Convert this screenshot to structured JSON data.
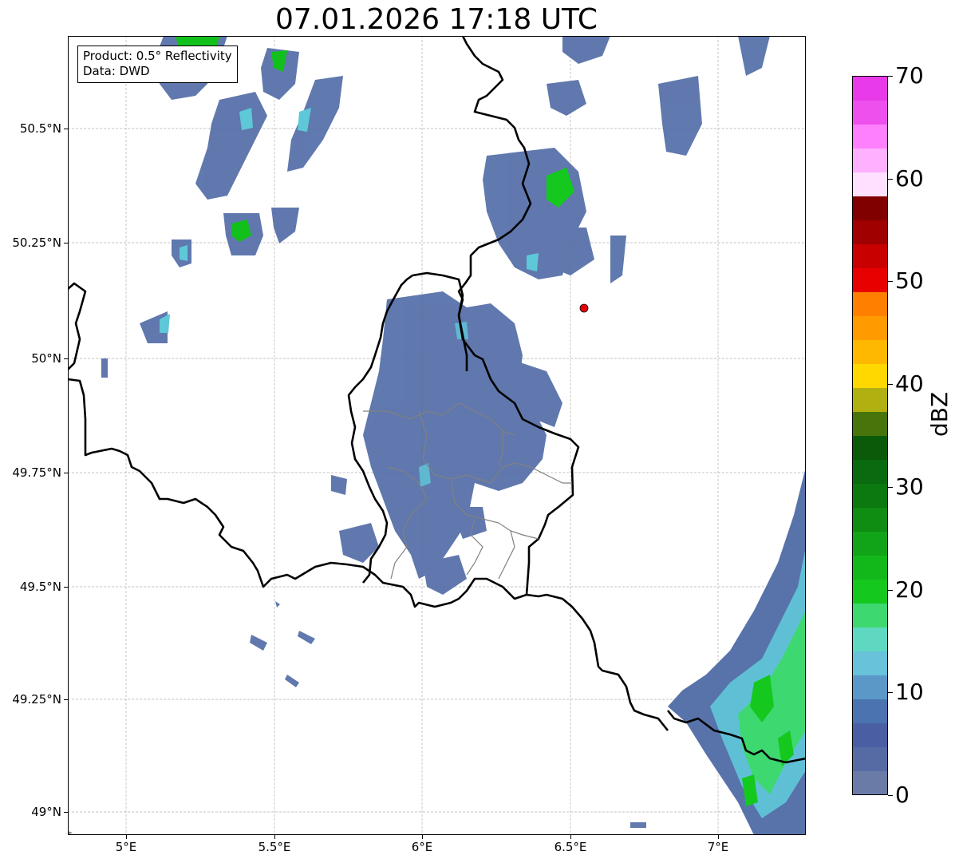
{
  "title": "07.01.2026 17:18 UTC",
  "info_box": {
    "product": "Product: 0.5° Reflectivity",
    "data": "Data: DWD"
  },
  "map": {
    "lat_ticks": [
      "50.5°N",
      "50.25°N",
      "50°N",
      "49.75°N",
      "49.5°N",
      "49.25°N",
      "49°N"
    ],
    "lon_ticks": [
      "5°E",
      "5.5°E",
      "6°E",
      "6.5°E",
      "7°E"
    ],
    "gridlines": true,
    "marker_color": "#e8000b",
    "border_color": "#000000",
    "admin_border_color": "#808080"
  },
  "colorbar": {
    "label": "dBZ",
    "ticks": [
      "0",
      "10",
      "20",
      "30",
      "40",
      "50",
      "60",
      "70"
    ],
    "range": [
      0,
      70
    ],
    "colors": [
      "#6a7ba8",
      "#566aa3",
      "#4a5fa3",
      "#4a73b0",
      "#5b98c8",
      "#68c2da",
      "#5fd8c2",
      "#3dd870",
      "#14c81e",
      "#12b81a",
      "#12a418",
      "#0f8c12",
      "#0b7810",
      "#0a6a10",
      "#0b5a0a",
      "#47750c",
      "#b0b010",
      "#ffd800",
      "#ffb800",
      "#ff9a00",
      "#ff8000",
      "#e80000",
      "#c80000",
      "#a00000",
      "#800000",
      "#ffe0ff",
      "#ffb0ff",
      "#ff80ff",
      "#ee50ee",
      "#e83ae8"
    ]
  }
}
